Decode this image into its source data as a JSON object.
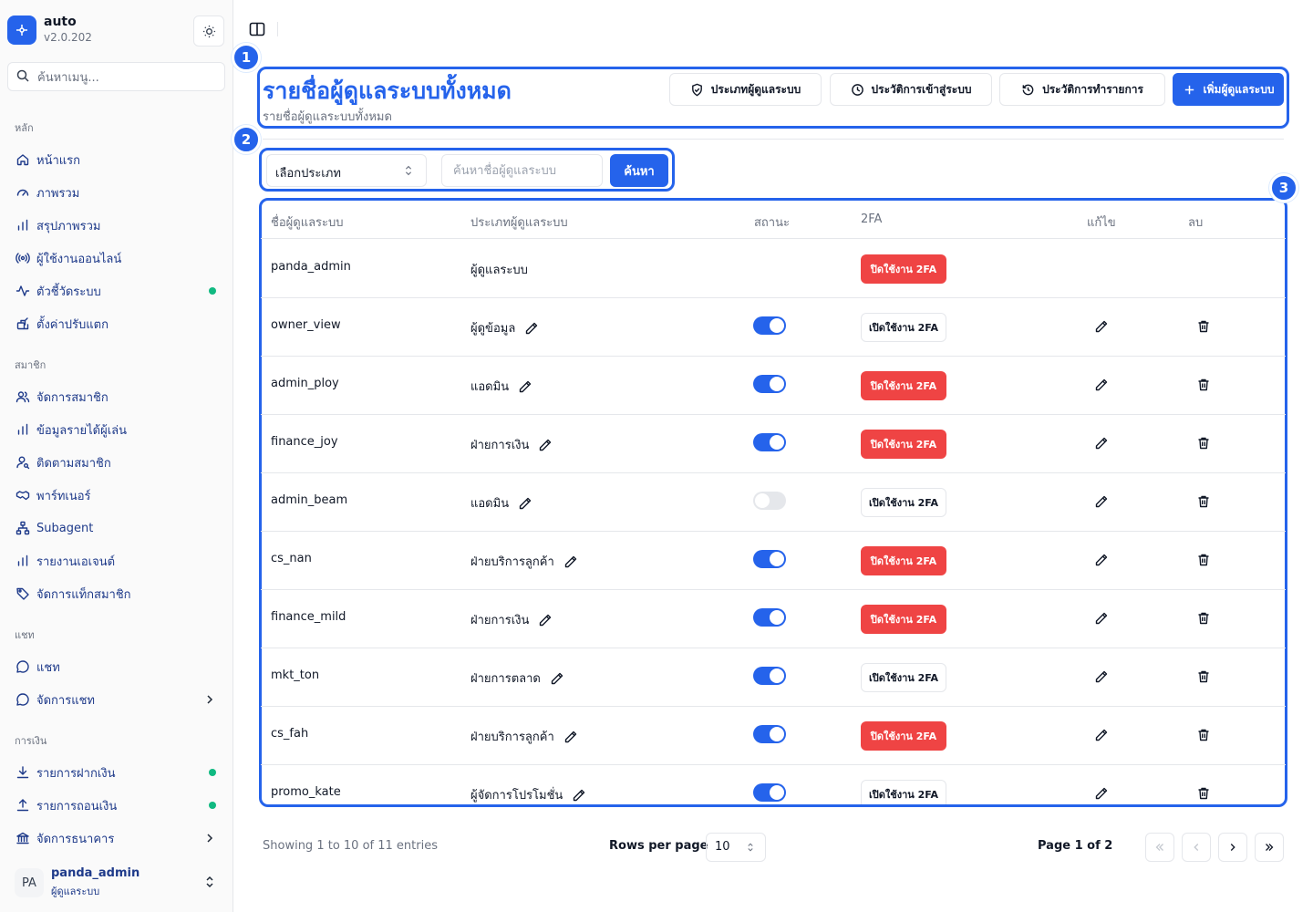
{
  "app": {
    "name": "auto",
    "version": "v2.0.202"
  },
  "sidebar": {
    "search_placeholder": "ค้นหาเมนู...",
    "groups": [
      {
        "label": "หลัก",
        "items": [
          {
            "label": "หน้าแรก",
            "icon": "home-icon"
          },
          {
            "label": "ภาพรวม",
            "icon": "gauge-icon"
          },
          {
            "label": "สรุปภาพรวม",
            "icon": "bar-chart-icon"
          },
          {
            "label": "ผู้ใช้งานออนไลน์",
            "icon": "radio-icon"
          },
          {
            "label": "ตัวชี้วัดระบบ",
            "icon": "activity-icon",
            "dot": true
          },
          {
            "label": "ตั้งค่าปรับแตก",
            "icon": "gift-icon"
          }
        ]
      },
      {
        "label": "สมาชิก",
        "items": [
          {
            "label": "จัดการสมาชิก",
            "icon": "users-icon"
          },
          {
            "label": "ข้อมูลรายได้ผู้เล่น",
            "icon": "bar-chart-icon"
          },
          {
            "label": "ติดตามสมาชิก",
            "icon": "user-search-icon"
          },
          {
            "label": "พาร์ทเนอร์",
            "icon": "handshake-icon"
          },
          {
            "label": "Subagent",
            "icon": "network-icon"
          },
          {
            "label": "รายงานเอเจนต์",
            "icon": "bar-chart-icon"
          },
          {
            "label": "จัดการแท็กสมาชิก",
            "icon": "tag-icon"
          }
        ]
      },
      {
        "label": "แชท",
        "items": [
          {
            "label": "แชท",
            "icon": "message-icon"
          },
          {
            "label": "จัดการแชท",
            "icon": "message-icon",
            "chevron": true
          }
        ]
      },
      {
        "label": "การเงิน",
        "items": [
          {
            "label": "รายการฝากเงิน",
            "icon": "download-icon",
            "dot": true
          },
          {
            "label": "รายการถอนเงิน",
            "icon": "upload-icon",
            "dot": true
          },
          {
            "label": "จัดการธนาคาร",
            "icon": "bank-icon",
            "chevron": true
          }
        ]
      }
    ],
    "user": {
      "initials": "PA",
      "name": "panda_admin",
      "role": "ผู้ดูแลระบบ"
    }
  },
  "markers": {
    "m1": "1",
    "m2": "2",
    "m3": "3"
  },
  "header": {
    "title": "รายชื่อผู้ดูแลระบบทั้งหมด",
    "subtitle": "รายชื่อผู้ดูแลระบบทั้งหมด",
    "buttons": {
      "types": "ประเภทผู้ดูแลระบบ",
      "login_history": "ประวัติการเข้าสู่ระบบ",
      "tx_history": "ประวัติการทำรายการ",
      "add": "เพิ่มผู้ดูแลระบบ"
    }
  },
  "filters": {
    "type_select": "เลือกประเภท",
    "search_placeholder": "ค้นหาชื่อผู้ดูแลระบบ",
    "search_button": "ค้นหา"
  },
  "table": {
    "columns": [
      "ชื่อผู้ดูแลระบบ",
      "ประเภทผู้ดูแลระบบ",
      "สถานะ",
      "2FA",
      "แก้ไข",
      "ลบ"
    ],
    "rows": [
      {
        "username": "panda_admin",
        "type": "ผู้ดูแลระบบ",
        "status": null,
        "twofa": "ปิดใช้งาน 2FA",
        "twofa_kind": "disable",
        "editable": false
      },
      {
        "username": "owner_view",
        "type": "ผู้ดูข้อมูล",
        "status": true,
        "twofa": "เปิดใช้งาน 2FA",
        "twofa_kind": "enable",
        "editable": true
      },
      {
        "username": "admin_ploy",
        "type": "แอดมิน",
        "status": true,
        "twofa": "ปิดใช้งาน 2FA",
        "twofa_kind": "disable",
        "editable": true
      },
      {
        "username": "finance_joy",
        "type": "ฝ่ายการเงิน",
        "status": true,
        "twofa": "ปิดใช้งาน 2FA",
        "twofa_kind": "disable",
        "editable": true
      },
      {
        "username": "admin_beam",
        "type": "แอดมิน",
        "status": false,
        "twofa": "เปิดใช้งาน 2FA",
        "twofa_kind": "enable",
        "editable": true
      },
      {
        "username": "cs_nan",
        "type": "ฝ่ายบริการลูกค้า",
        "status": true,
        "twofa": "ปิดใช้งาน 2FA",
        "twofa_kind": "disable",
        "editable": true
      },
      {
        "username": "finance_mild",
        "type": "ฝ่ายการเงิน",
        "status": true,
        "twofa": "ปิดใช้งาน 2FA",
        "twofa_kind": "disable",
        "editable": true
      },
      {
        "username": "mkt_ton",
        "type": "ฝ่ายการตลาด",
        "status": true,
        "twofa": "เปิดใช้งาน 2FA",
        "twofa_kind": "enable",
        "editable": true
      },
      {
        "username": "cs_fah",
        "type": "ฝ่ายบริการลูกค้า",
        "status": true,
        "twofa": "ปิดใช้งาน 2FA",
        "twofa_kind": "disable",
        "editable": true
      },
      {
        "username": "promo_kate",
        "type": "ผู้จัดการโปรโมชั่น",
        "status": true,
        "twofa": "เปิดใช้งาน 2FA",
        "twofa_kind": "enable",
        "editable": true
      }
    ]
  },
  "footer": {
    "showing": "Showing 1 to 10 of 11 entries",
    "rows_per_page_label": "Rows per page",
    "rows_per_page": "10",
    "page_info": "Page 1 of 2"
  },
  "colors": {
    "accent": "#2563eb",
    "danger": "#ef4444",
    "online": "#10b981"
  }
}
